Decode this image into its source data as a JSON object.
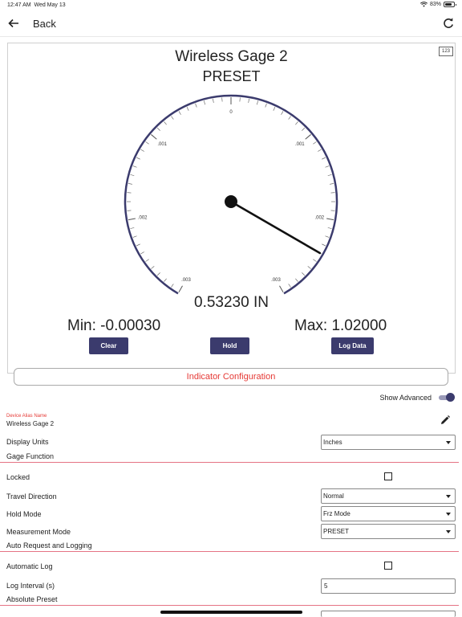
{
  "status": {
    "time": "12:47 AM",
    "date": "Wed May 13",
    "battery": "83%",
    "battery_level": 0.83
  },
  "topbar": {
    "back_label": "Back"
  },
  "gauge": {
    "badge": "123",
    "title": "Wireless Gage 2",
    "mode": "PRESET",
    "scale_labels": [
      ".003",
      ".002",
      ".001",
      "0",
      ".001",
      ".002",
      ".003"
    ],
    "reading": "0.53230 IN",
    "min": "Min: -0.00030",
    "max": "Max: 1.02000",
    "clear_label": "Clear",
    "hold_label": "Hold",
    "log_label": "Log Data"
  },
  "config": {
    "button_label": "Indicator Configuration",
    "show_advanced_label": "Show Advanced",
    "show_advanced_on": true,
    "alias_label": "Device Alias Name",
    "alias_value": "Wireless Gage 2",
    "display_units_label": "Display Units",
    "display_units_value": "Inches",
    "gage_function_section": "Gage Function",
    "locked_label": "Locked",
    "travel_direction_label": "Travel Direction",
    "travel_direction_value": "Normal",
    "hold_mode_label": "Hold Mode",
    "hold_mode_value": "Frz Mode",
    "measurement_mode_label": "Measurement Mode",
    "measurement_mode_value": "PRESET",
    "auto_section": "Auto Request and Logging",
    "automatic_log_label": "Automatic Log",
    "log_interval_label": "Log Interval (s)",
    "log_interval_value": "5",
    "absolute_preset_section": "Absolute Preset"
  },
  "colors": {
    "accent": "#3b3b6d",
    "red": "#e53935",
    "divider": "#e57384"
  }
}
